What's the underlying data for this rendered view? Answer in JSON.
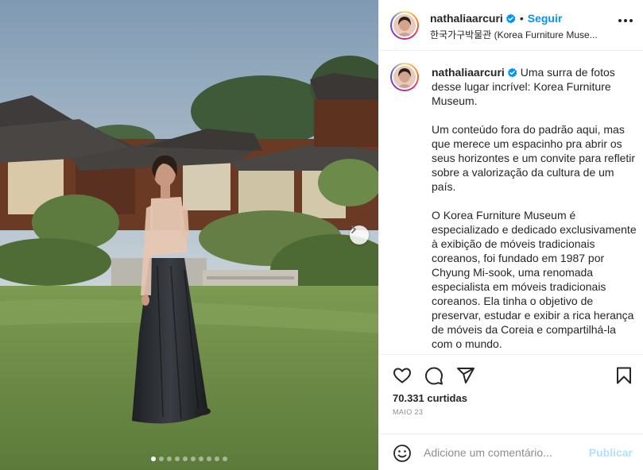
{
  "post": {
    "photo_alt": "",
    "carousel": {
      "total": 10,
      "active_index": 0
    }
  },
  "header": {
    "username": "nathaliaarcuri",
    "separator": "•",
    "follow_label": "Seguir",
    "location": "한국가구박물관 (Korea Furniture Muse..."
  },
  "caption": {
    "username": "nathaliaarcuri",
    "paragraphs": [
      "Uma surra de fotos desse lugar incrível: Korea Furniture Museum.",
      "Um conteúdo fora do padrão aqui, mas que merece um espacinho pra abrir os seus horizontes e um convite para refletir sobre a valorização da cultura de um país.",
      "O Korea Furniture Museum é especializado e dedicado exclusivamente à exibição de móveis tradicionais coreanos, foi fundado em 1987 por Chyung Mi-sook, uma renomada especialista em móveis tradicionais coreanos. Ela tinha o objetivo de preservar, estudar e exibir a rica herança de móveis da Coreia e compartilhá-la com o mundo."
    ]
  },
  "stats": {
    "likes": "70.331 curtidas",
    "date": "MAIO 23"
  },
  "comment": {
    "placeholder": "Adicione um comentário...",
    "publish_label": "Publicar"
  },
  "icons": {
    "like": "heart-icon",
    "comment": "comment-icon",
    "share": "share-icon",
    "save": "bookmark-icon",
    "more": "more-options-icon",
    "emoji": "emoji-icon",
    "verified": "verified-badge-icon",
    "next": "chevron-right-icon"
  },
  "colors": {
    "accent": "#0095f6",
    "verified": "#0095f6",
    "publish_disabled": "#b2dffc",
    "muted": "#8e8e8e"
  }
}
